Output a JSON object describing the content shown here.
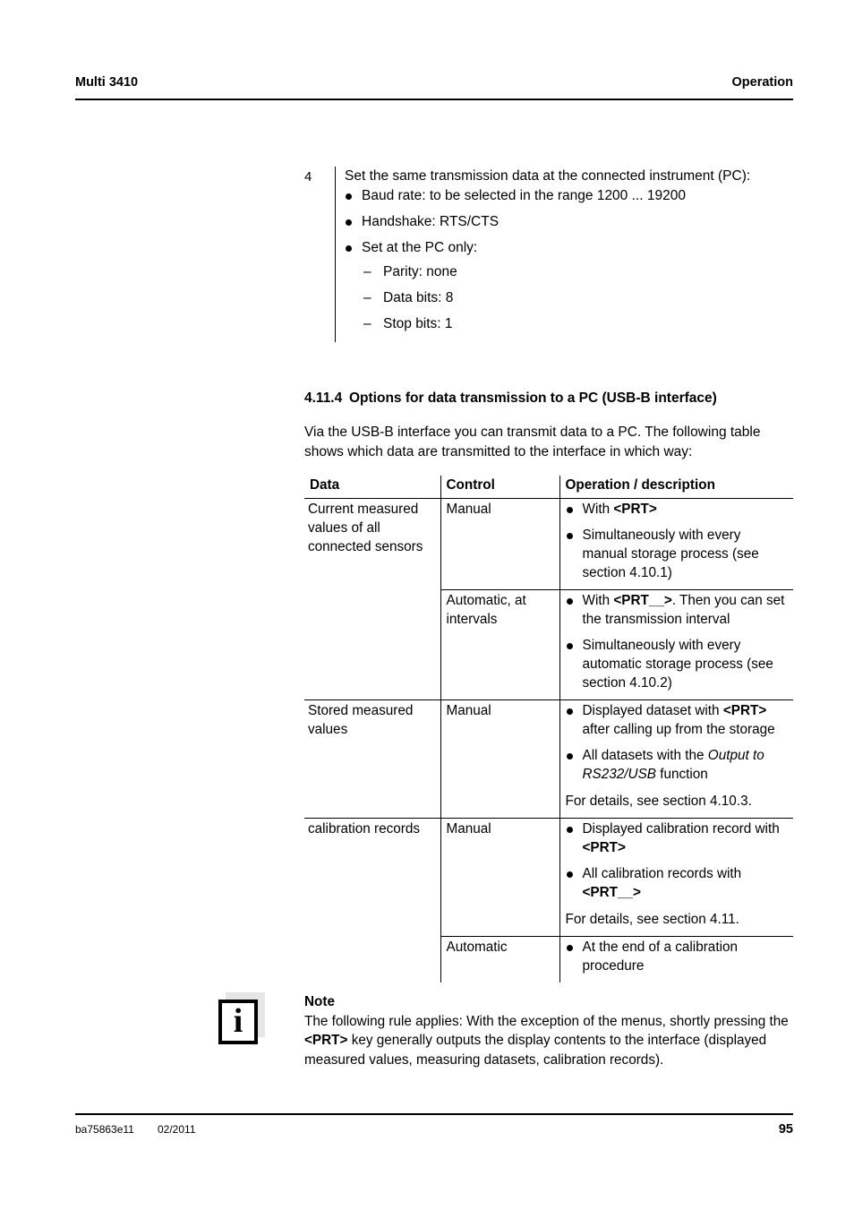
{
  "header": {
    "left": "Multi 3410",
    "right": "Operation"
  },
  "step": {
    "number": "4",
    "lead": "Set the same transmission data at the connected instrument (PC):",
    "bullets": [
      "Baud rate: to be selected in the range 1200 ... 19200",
      "Handshake: RTS/CTS",
      "Set at the PC only:"
    ],
    "sub_items": [
      "Parity: none",
      "Data bits: 8",
      "Stop bits: 1"
    ]
  },
  "section": {
    "number": "4.11.4",
    "title": "Options for data transmission to a PC (USB-B interface)",
    "intro": "Via the USB-B interface you can transmit data to a PC. The following table shows which data are transmitted to the interface in which way:"
  },
  "table": {
    "headers": [
      "Data",
      "Control",
      "Operation / description"
    ],
    "rows": [
      {
        "data": "Current measured values of all connected sensors",
        "control": "Manual",
        "bullets": [
          {
            "prefix": "With ",
            "key": "<PRT>",
            "suffix": ""
          },
          {
            "prefix": "Simultaneously with every manual storage process (see section 4.10.1)",
            "key": "",
            "suffix": ""
          }
        ],
        "note": ""
      },
      {
        "data": "",
        "control": "Automatic, at intervals",
        "bullets": [
          {
            "prefix": "With ",
            "key": "<PRT__>",
            "suffix": ". Then you can set the transmission interval"
          },
          {
            "prefix": "Simultaneously with every automatic storage process (see section 4.10.2)",
            "key": "",
            "suffix": ""
          }
        ],
        "note": ""
      },
      {
        "data": "Stored measured values",
        "control": "Manual",
        "bullets": [
          {
            "prefix": "Displayed dataset with ",
            "key": "<PRT>",
            "suffix": " after calling up from the storage"
          },
          {
            "prefix": "All datasets with the ",
            "italic": "Output to RS232/USB",
            "suffix": " function"
          }
        ],
        "note": "For details, see section 4.10.3."
      },
      {
        "data": "calibration records",
        "control": "Manual",
        "bullets": [
          {
            "prefix": "Displayed calibration record with ",
            "key": "<PRT>",
            "suffix": ""
          },
          {
            "prefix": "All calibration records with ",
            "key": "<PRT__>",
            "suffix": ""
          }
        ],
        "note": "For details, see section 4.11."
      },
      {
        "data": "",
        "control": "Automatic",
        "bullets": [
          {
            "prefix": "At the end of a calibration procedure",
            "key": "",
            "suffix": ""
          }
        ],
        "note": ""
      }
    ]
  },
  "note": {
    "icon": "info-icon",
    "icon_glyph": "i",
    "title": "Note",
    "body_part1": "The following rule applies: With the exception of the menus, shortly pressing the ",
    "body_key": "<PRT>",
    "body_part2": " key generally outputs the display contents to the interface (displayed measured values, measuring datasets, calibration records)."
  },
  "footer": {
    "doc_id": "ba75863e11",
    "date": "02/2011",
    "page_number": "95"
  }
}
